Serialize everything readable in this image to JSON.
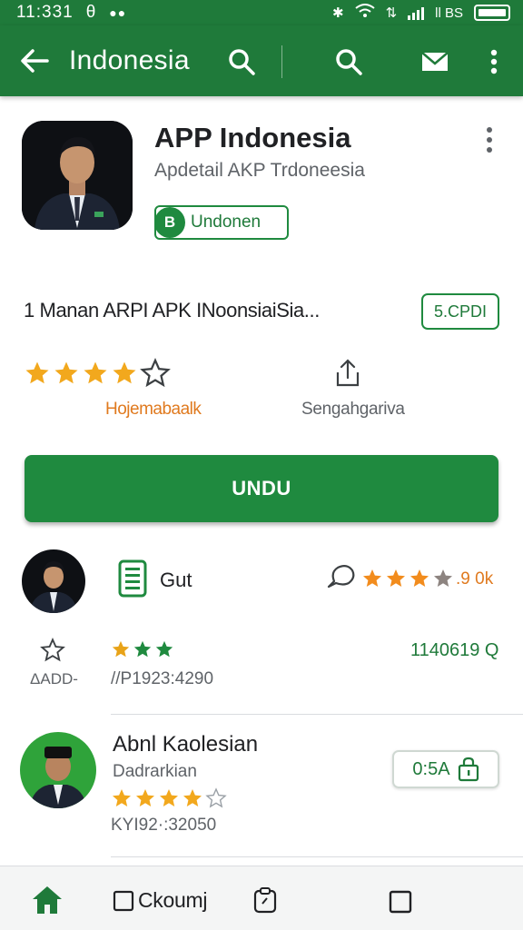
{
  "status_bar": {
    "time": "11:331",
    "extra": "θ",
    "right_text": "ll ΒS"
  },
  "app_bar": {
    "title": "Indonesia"
  },
  "app": {
    "name": "APP Indonesia",
    "developer": "Apdetail AKP Trdoneesia",
    "badge_label": "Undonen",
    "badge_icon_glyph": "B",
    "description": "1 Manan ARPI APK INoonsiaiSia...",
    "size_label": "5.CPDI",
    "rating_label": "Hojemabaalk",
    "share_label": "Sengahgariva",
    "install_label": "UNDU",
    "rating_stars_filled": 4,
    "rating_stars_total": 5
  },
  "reviews": [
    {
      "label": "Gut",
      "rating_text": ".9 0k",
      "stars_filled": 3,
      "stars_total": 4,
      "left_code": "ΔADD-",
      "date": "//P1923:4290",
      "count": "1140619 Q",
      "green_stars": 3
    }
  ],
  "person": {
    "name": "Abnl Kaolesian",
    "subtitle": "Dadrarkian",
    "date": "ΚΥΙ92·:32050",
    "stars_filled": 4.5,
    "stars_total": 5,
    "price_label": "0:5A"
  },
  "bottom_nav": {
    "item2_label": "Ckoumj"
  },
  "colors": {
    "primary": "#1f7a3a",
    "button": "#1f8a3f",
    "star_orange": "#f2a81d",
    "star_green": "#1f8a3f"
  }
}
